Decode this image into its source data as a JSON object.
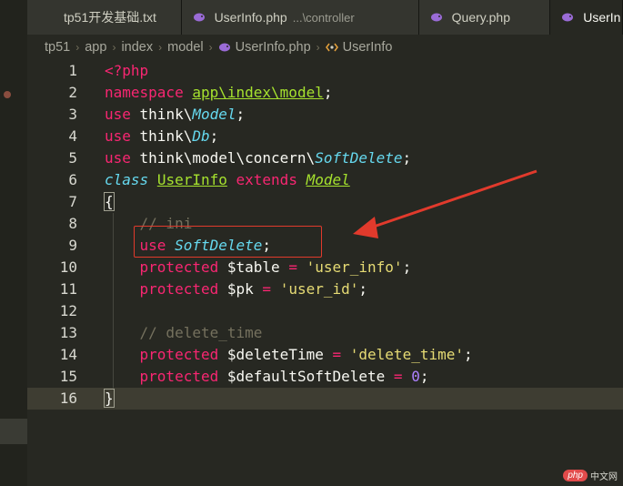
{
  "tabs": [
    {
      "label": "tp51开发基础.txt",
      "sub": ""
    },
    {
      "label": "UserInfo.php",
      "sub": "...\\controller"
    },
    {
      "label": "Query.php",
      "sub": ""
    },
    {
      "label": "UserIn",
      "sub": ""
    }
  ],
  "breadcrumb": [
    "tp51",
    "app",
    "index",
    "model",
    "UserInfo.php",
    "UserInfo"
  ],
  "line_numbers": [
    "1",
    "2",
    "3",
    "4",
    "5",
    "6",
    "7",
    "8",
    "9",
    "10",
    "11",
    "12",
    "13",
    "14",
    "15",
    "16"
  ],
  "code": {
    "l1_open": "<?php",
    "l2_kw": "namespace",
    "l2_ns": "app\\index\\model",
    "l2_end": ";",
    "l3_kw": "use",
    "l3_path": " think\\",
    "l3_ty": "Model",
    "l3_end": ";",
    "l4_kw": "use",
    "l4_path": " think\\",
    "l4_ty": "Db",
    "l4_end": ";",
    "l5_kw": "use",
    "l5_path": " think\\model\\concern\\",
    "l5_ty": "SoftDelete",
    "l5_end": ";",
    "l6_kw": "class",
    "l6_cls": "UserInfo",
    "l6_ext": "extends",
    "l6_parent": "Model",
    "l7_brace": "{",
    "l8_comment": "// ini",
    "l9_kw": "use",
    "l9_ty": "SoftDelete",
    "l9_end": ";",
    "l10_kw": "protected",
    "l10_var": "$table",
    "l10_eq": "=",
    "l10_str": "'user_info'",
    "l10_end": ";",
    "l11_kw": "protected",
    "l11_var": "$pk",
    "l11_eq": "=",
    "l11_str": "'user_id'",
    "l11_end": ";",
    "l13_comment": "// delete_time",
    "l14_kw": "protected",
    "l14_var": "$deleteTime",
    "l14_eq": "=",
    "l14_str": "'delete_time'",
    "l14_end": ";",
    "l15_kw": "protected",
    "l15_var": "$defaultSoftDelete",
    "l15_eq": "=",
    "l15_num": "0",
    "l15_end": ";",
    "l16_brace": "}"
  },
  "watermark": {
    "badge": "php",
    "text": "中文网"
  },
  "colors": {
    "annotation": "#e13a2c",
    "background": "#272822",
    "keyword": "#f92672",
    "type": "#66d9ef",
    "class": "#a6e22e",
    "string": "#e6db74",
    "comment": "#75715e"
  },
  "icons": {
    "tab_file": "php-elephant-icon",
    "breadcrumb_class": "class-icon"
  }
}
